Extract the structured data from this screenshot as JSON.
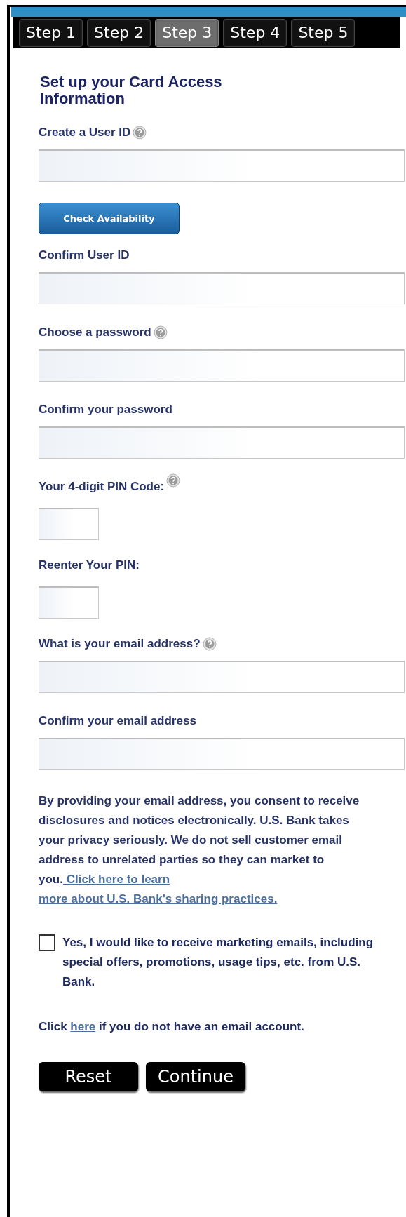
{
  "tabs": [
    {
      "label": "Step 1",
      "selected": false
    },
    {
      "label": "Step 2",
      "selected": false
    },
    {
      "label": "Step 3",
      "selected": true
    },
    {
      "label": "Step 4",
      "selected": false
    },
    {
      "label": "Step 5",
      "selected": false
    }
  ],
  "heading": "Set up your Card Access Information",
  "form": [
    {
      "kind": "field",
      "label": "Create a User ID",
      "help": true
    },
    {
      "kind": "button",
      "label": "Check Availability"
    },
    {
      "kind": "field",
      "label": "Confirm User ID",
      "help": false
    },
    {
      "kind": "field",
      "label": "Choose a password",
      "help": true
    },
    {
      "kind": "field",
      "label": "Confirm your password",
      "help": false
    },
    {
      "kind": "pin",
      "label": "Your 4-digit PIN Code:",
      "help": true
    },
    {
      "kind": "pin",
      "label": "Reenter Your PIN:",
      "help": false
    },
    {
      "kind": "field",
      "label": "What is your email address?",
      "help": true
    },
    {
      "kind": "field",
      "label": "Confirm your email address",
      "help": false
    }
  ],
  "disclosure": {
    "text": "By providing your email address, you consent to receive disclosures and notices electronically. U.S. Bank takes your privacy seriously. We do not sell customer email address to unrelated parties so they can market to you.",
    "link_lines": [
      " Click here to learn",
      "more about U.S. Bank's sharing practices."
    ]
  },
  "marketing": {
    "checked": false,
    "label": "Yes, I would like to receive marketing emails, including special offers, promotions, usage tips, etc. from U.S. Bank."
  },
  "no_email": {
    "before": "Click ",
    "link": "here",
    "after": " if you do not have an email account."
  },
  "buttons": [
    "Reset",
    "Continue"
  ]
}
